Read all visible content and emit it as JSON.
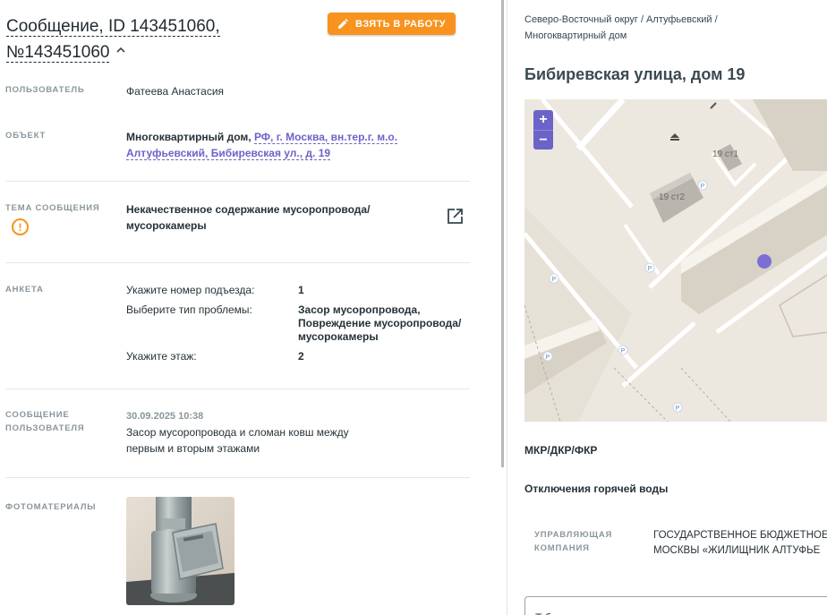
{
  "header": {
    "title_line1": "Сообщение, ID 143451060,",
    "title_line2": "№143451060",
    "take_button": "ВЗЯТЬ В РАБОТУ"
  },
  "fields": {
    "user_label": "ПОЛЬЗОВАТЕЛЬ",
    "user_value": "Фатеева Анастасия",
    "object_label": "ОБЪЕКТ",
    "object_type": "Многоквартирный дом,",
    "object_link_line1": "РФ, г. Москва, вн.тер.г. м.о.",
    "object_link_line2": "Алтуфьевский, Бибиревская ул., д. 19",
    "topic_label": "ТЕМА СООБЩЕНИЯ",
    "topic_line1": "Некачественное содержание мусоропровода/",
    "topic_line2": "мусорокамеры",
    "survey_label": "АНКЕТА",
    "survey": [
      {
        "q": "Укажите номер подъезда:",
        "a": [
          "1"
        ]
      },
      {
        "q": "Выберите тип проблемы:",
        "a": [
          "Засор мусоропровода,",
          "Повреждение мусоропровода/",
          "мусорокамеры"
        ]
      },
      {
        "q": "Укажите этаж:",
        "a": [
          "2"
        ]
      }
    ],
    "message_label_line1": "СООБЩЕНИЕ",
    "message_label_line2": "ПОЛЬЗОВАТЕЛЯ",
    "message_date": "30.09.2025 10:38",
    "message_line1": "Засор мусоропровода и сломан ковш между",
    "message_line2": "первым и вторым этажами",
    "photos_label": "ФОТОМАТЕРИАЛЫ"
  },
  "right": {
    "breadcrumb_line1": "Северо-Восточный округ / Алтуфьевский /",
    "breadcrumb_line2": "Многоквартирный дом",
    "address": "Бибиревская улица, дом 19",
    "map": {
      "zoom_in": "+",
      "zoom_out": "−",
      "building1": "19 ст1",
      "building2": "19 ст2",
      "parking": "P"
    },
    "section1": "МКР/ДКР/ФКР",
    "section2": "Отключения горячей воды",
    "mc_label_line1": "УПРАВЛЯЮЩАЯ",
    "mc_label_line2": "КОМПАНИЯ",
    "mc_value_line1": "ГОСУДАРСТВЕННОЕ БЮДЖЕТНОЕ",
    "mc_value_line2": "МОСКВЫ «ЖИЛИЩНИК АЛТУФЬЕ",
    "input_partial": "Т        б"
  },
  "colors": {
    "accent": "#f7931e",
    "link": "#6c63c9",
    "map_marker": "#7b6fd6"
  }
}
